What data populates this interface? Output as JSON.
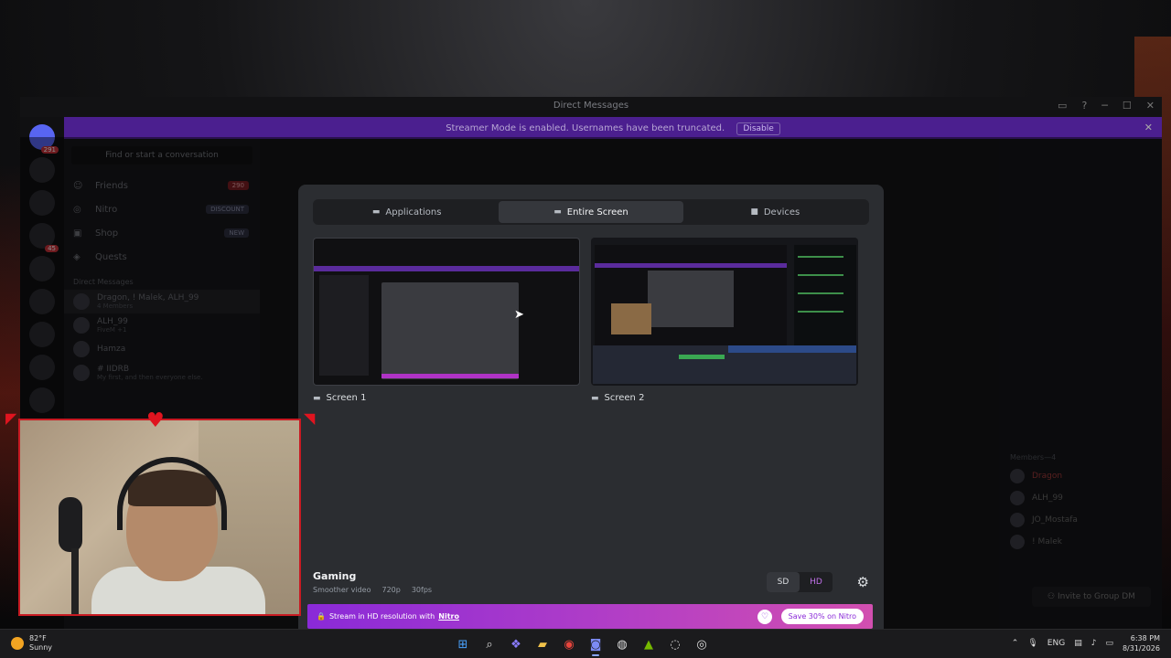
{
  "window": {
    "title": "Direct Messages"
  },
  "banner": {
    "text": "Streamer Mode is enabled. Usernames have been truncated.",
    "disable_label": "Disable"
  },
  "servers": {
    "badge_top": "291",
    "badge_mid": "45"
  },
  "sidebar": {
    "search_placeholder": "Find or start a conversation",
    "nav": [
      {
        "label": "Friends",
        "pill": "290"
      },
      {
        "label": "Nitro",
        "pill": "DISCOUNT"
      },
      {
        "label": "Shop",
        "pill": "NEW"
      },
      {
        "label": "Quests",
        "pill": ""
      }
    ],
    "dm_header": "Direct Messages",
    "dms": [
      {
        "name": "Dragon, ! Malek, ALH_99",
        "sub": "4 Members"
      },
      {
        "name": "ALH_99",
        "sub": "FiveM +1"
      },
      {
        "name": "Hamza",
        "sub": ""
      },
      {
        "name": "# IIDRB",
        "sub": "My first, and then everyone else."
      }
    ]
  },
  "members": {
    "header": "Members—4",
    "list": [
      "Dragon",
      "ALH_99",
      "JO_Mostafa",
      "! Malek"
    ],
    "invite_label": "Invite to Group DM"
  },
  "modal": {
    "tabs": [
      {
        "label": "Applications",
        "icon": "window-icon"
      },
      {
        "label": "Entire Screen",
        "icon": "monitor-icon"
      },
      {
        "label": "Devices",
        "icon": "camera-icon"
      }
    ],
    "active_tab": "Entire Screen",
    "screens": [
      {
        "label": "Screen 1"
      },
      {
        "label": "Screen 2"
      }
    ],
    "stream_preset": {
      "title": "Gaming",
      "desc": "Smoother video",
      "resolution": "720p",
      "fps": "30fps"
    },
    "quality": {
      "sd": "SD",
      "hd": "HD",
      "selected": "SD"
    },
    "nitro": {
      "text": "Stream in HD resolution with",
      "link": "Nitro",
      "cta": "Save 30% on Nitro"
    }
  },
  "taskbar": {
    "weather": {
      "temp": "82°F",
      "cond": "Sunny"
    },
    "lang": "ENG",
    "time": "6:38 PM",
    "date": "8/31/2026"
  }
}
